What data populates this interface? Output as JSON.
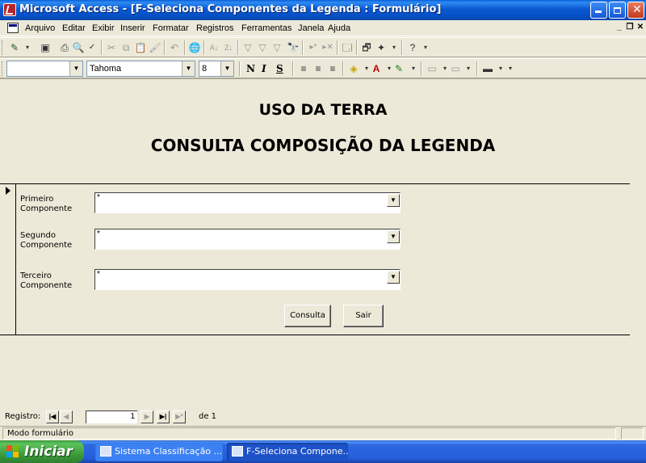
{
  "window": {
    "title": "Microsoft Access - [F-Seleciona Componentes da Legenda : Formulário]"
  },
  "menubar": {
    "items": [
      "Arquivo",
      "Editar",
      "Exibir",
      "Inserir",
      "Formatar",
      "Registros",
      "Ferramentas",
      "Janela",
      "Ajuda"
    ]
  },
  "format_toolbar": {
    "object_value": "",
    "font_value": "Tahoma",
    "size_value": "8",
    "bold": "N",
    "italic": "I",
    "underline": "S"
  },
  "form": {
    "title": "USO DA TERRA",
    "subtitle": "CONSULTA COMPOSIÇÃO DA LEGENDA",
    "fields": [
      {
        "label_line1": "Primeiro",
        "label_line2": "Componente",
        "value": "*"
      },
      {
        "label_line1": "Segundo",
        "label_line2": "Componente",
        "value": "*"
      },
      {
        "label_line1": "Terceiro",
        "label_line2": "Componente",
        "value": "*"
      }
    ],
    "consulta_label": "Consulta",
    "sair_label": "Sair"
  },
  "navigation": {
    "label": "Registro:",
    "current": "1",
    "of_label": "de 1"
  },
  "status": {
    "text": "Modo formulário"
  },
  "taskbar": {
    "start_label": "Iniciar",
    "tasks": [
      "Sistema Classificação ...",
      "F-Seleciona Compone..."
    ]
  }
}
